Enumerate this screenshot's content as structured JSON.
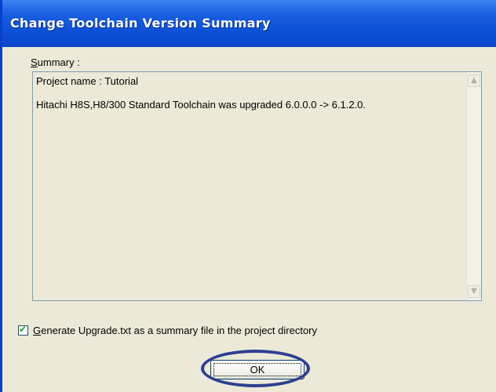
{
  "window": {
    "title": "Change Toolchain Version Summary"
  },
  "summary": {
    "label_mnemonic": "S",
    "label_rest": "ummary :",
    "lines": [
      "Project name : Tutorial",
      "Hitachi H8S,H8/300 Standard Toolchain was upgraded 6.0.0.0 -> 6.1.2.0."
    ]
  },
  "scrollbar": {
    "up_icon": "▲",
    "down_icon": "▼"
  },
  "checkbox": {
    "checked": true,
    "check_glyph": "✔",
    "label_mnemonic": "G",
    "label_rest": "enerate Upgrade.txt as a summary file in the project directory"
  },
  "buttons": {
    "ok_label": "OK"
  },
  "colors": {
    "title_bar": "#0b4fd6",
    "dialog_face": "#ece9d8",
    "highlight_ellipse": "#2d3f90"
  }
}
